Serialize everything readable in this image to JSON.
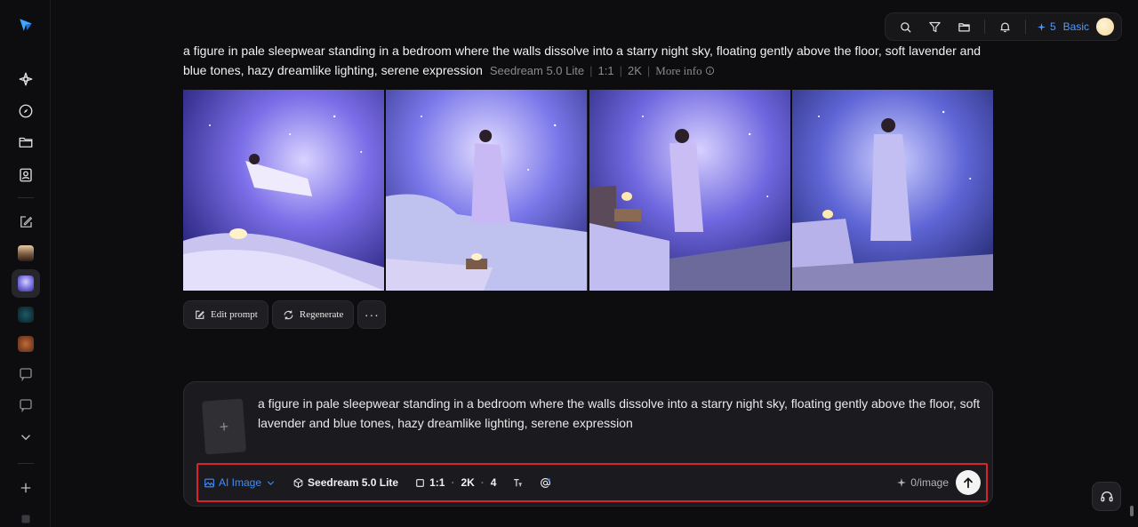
{
  "header": {
    "credits": "5",
    "plan": "Basic"
  },
  "generation": {
    "prompt": "a figure in pale sleepwear standing in a bedroom where the walls dissolve into a starry night sky, floating gently above the floor, soft lavender and blue tones, hazy dreamlike lighting, serene expression",
    "model": "Seedream 5.0 Lite",
    "ratio": "1:1",
    "resolution": "2K",
    "more_info": "More info"
  },
  "actions": {
    "edit_prompt": "Edit prompt",
    "regenerate": "Regenerate",
    "more": "···"
  },
  "composer": {
    "text": "a figure in pale sleepwear standing in a bedroom where the walls dissolve into a starry night sky, floating gently above the floor, soft lavender and blue tones, hazy dreamlike lighting, serene expression",
    "mode": "AI Image",
    "model": "Seedream 5.0 Lite",
    "ratio": "1:1",
    "resolution": "2K",
    "count": "4",
    "cost": "0/image"
  },
  "colors": {
    "accent": "#3d8eff",
    "highlight_border": "#d9222b"
  }
}
